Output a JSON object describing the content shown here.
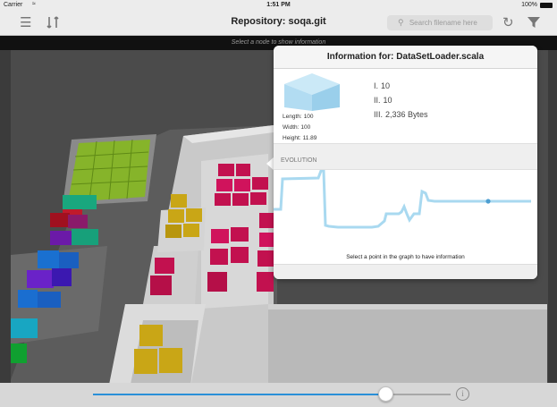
{
  "status_bar": {
    "carrier": "Carrier",
    "wifi_icon": "wifi-icon",
    "time": "1:51 PM",
    "battery": "100%"
  },
  "navbar": {
    "title": "Repository: soqa.git",
    "search_placeholder": "Search filename here",
    "icons": [
      "menu-icon",
      "branch-icon",
      "refresh-icon",
      "filter-icon"
    ]
  },
  "scene": {
    "hint": "Select a node to show information"
  },
  "popover": {
    "header_label": "Information for:",
    "file_name": "DataSetLoader.scala",
    "dimensions": [
      {
        "key": "Length:",
        "value": "100"
      },
      {
        "key": "Width:",
        "value": "100"
      },
      {
        "key": "Height:",
        "value": "11.89"
      }
    ],
    "metrics": [
      {
        "key": "I.",
        "value": "10"
      },
      {
        "key": "II.",
        "value": "10"
      },
      {
        "key": "III.",
        "value": "2,336 Bytes"
      }
    ],
    "evolution_label": "EVOLUTION",
    "graph_hint": "Select a point in the graph to have information"
  },
  "bottom_bar": {
    "timeline_position": 0.82,
    "info_label": "i"
  },
  "colors": {
    "accent": "#2a8fd8",
    "graph_line": "#a9d9f0",
    "cube": "#aad8f0"
  }
}
